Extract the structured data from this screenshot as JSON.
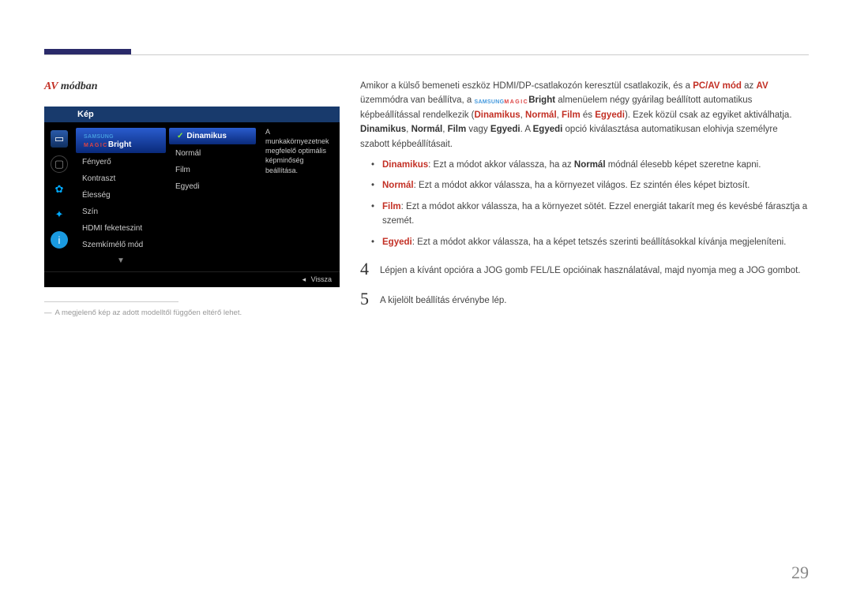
{
  "page_number": "29",
  "title": {
    "prefix": "AV",
    "suffix": " módban"
  },
  "osd": {
    "header": "Kép",
    "col1": {
      "selected_prefix1": "SAMSUNG",
      "selected_prefix2": "MAGIC",
      "selected_suffix": "Bright",
      "items": [
        "Fényerő",
        "Kontraszt",
        "Élesség",
        "Szín",
        "HDMI feketeszint",
        "Szemkímélő mód"
      ]
    },
    "col2": {
      "selected": "Dinamikus",
      "items": [
        "Normál",
        "Film",
        "Egyedi"
      ]
    },
    "desc": "A munkakörnyezetnek megfelelő optimális képminőség beállítása.",
    "down_arrow": "▼",
    "back_arrow": "◂",
    "back_label": "Vissza"
  },
  "note": "A megjelenő kép az adott modelltől függően eltérő lehet.",
  "intro": {
    "t1": "Amikor a külső bemeneti eszköz HDMI/DP-csatlakozón keresztül csatlakozik, és a ",
    "pcav": "PC/AV mód",
    "t2": " az ",
    "av": "AV",
    "t3": " üzemmódra van beállítva, a ",
    "samsung": "SAMSUNG",
    "magic": "MAGIC",
    "bright": "Bright",
    "t4": " almenüelem négy gyárilag beállított automatikus képbeállítással rendelkezik (",
    "o1": "Dinamikus",
    "c1": ", ",
    "o2": "Normál",
    "c2": ", ",
    "o3": "Film",
    "t5": " és ",
    "o4": "Egyedi",
    "t6": "). Ezek közül csak az egyiket aktiválhatja. ",
    "s1": "Dinamikus",
    "cs1": ", ",
    "s2": "Normál",
    "cs2": ", ",
    "s3": "Film",
    "t7": " vagy ",
    "s4": "Egyedi",
    "t8": ". A ",
    "s5": "Egyedi",
    "t9": " opció kiválasztása automatikusan elohivja személyre szabott képbeállításait."
  },
  "bullets": {
    "b1": {
      "label": "Dinamikus",
      "mid": ": Ezt a módot akkor válassza, ha az ",
      "bold": "Normál",
      "rest": " módnál élesebb képet szeretne kapni."
    },
    "b2": {
      "label": "Normál",
      "rest": ": Ezt a módot akkor válassza, ha a környezet világos. Ez szintén éles képet biztosít."
    },
    "b3": {
      "label": "Film",
      "rest": ": Ezt a módot akkor válassza, ha a környezet sötét. Ezzel energiát takarít meg és kevésbé fárasztja a szemét."
    },
    "b4": {
      "label": "Egyedi",
      "rest": ": Ezt a módot akkor válassza, ha a képet tetszés szerinti beállításokkal kívánja megjeleníteni."
    }
  },
  "steps": {
    "s4": {
      "num": "4",
      "text": "Lépjen a kívánt opcióra a JOG gomb FEL/LE opcióinak használatával, majd nyomja meg a JOG gombot."
    },
    "s5": {
      "num": "5",
      "text": "A kijelölt beállítás érvénybe lép."
    }
  }
}
